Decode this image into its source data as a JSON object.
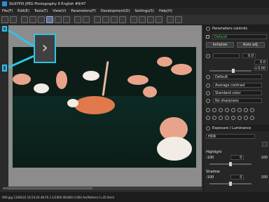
{
  "window": {
    "title": "SILKYPIX JPEG Photography 9 English  #9/47"
  },
  "menu": [
    "File(F)",
    "Edit(E)",
    "Tools(T)",
    "View(V)",
    "Parameters(P)",
    "Development(D)",
    "Settings(S)",
    "Help(H)"
  ],
  "panel": {
    "header": "Parameters controls",
    "preset_value": "Default",
    "initialize_label": "Initialize",
    "auto_adj_label": "Auto adj.",
    "wb_values": [
      "0.0",
      "0.0",
      "+3.00"
    ],
    "default_label": "Default",
    "tone_label": "Average contrast",
    "color_label": "Standard color",
    "sharpness_label": "No sharpness",
    "exposure_header": "Exposure / Luminance",
    "hdr_label": "HDR",
    "highlight_label": "Highlight",
    "highlight_values": [
      "-100",
      "0",
      "100"
    ],
    "shadow_label": "Shadow",
    "shadow_values": [
      "-100",
      "0",
      "100"
    ]
  },
  "status": {
    "text": "009.jpg 13/06/22 16:24:24.48 F6.3 1/2000 ISO400  0.0EV  Av(Pattern) f=35.0mm"
  },
  "callout": {
    "glyph": "›"
  },
  "colors": {
    "accent": "#2ec4e6",
    "selection": "#5a6e86",
    "preset_text": "#3cc94a"
  }
}
